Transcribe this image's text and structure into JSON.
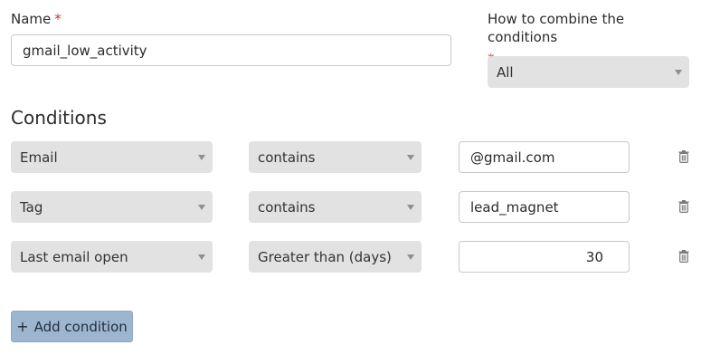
{
  "form": {
    "name_label": "Name",
    "required_marker": "*",
    "name_value": "gmail_low_activity",
    "combine_label": "How to combine the conditions",
    "combine_value": "All"
  },
  "conditions": {
    "heading": "Conditions",
    "rows": [
      {
        "field": "Email",
        "operator": "contains",
        "value": "@gmail.com"
      },
      {
        "field": "Tag",
        "operator": "contains",
        "value": "lead_magnet"
      },
      {
        "field": "Last email open",
        "operator": "Greater than (days)",
        "value": "30"
      }
    ]
  },
  "actions": {
    "add_condition_label": "Add condition",
    "add_icon": "+"
  },
  "icons": {
    "delete": "trash-icon",
    "dropdown": "chevron-down-icon"
  },
  "colors": {
    "required": "#c0392b",
    "select_bg": "#e2e2e2",
    "button_bg": "#9db6cf"
  }
}
